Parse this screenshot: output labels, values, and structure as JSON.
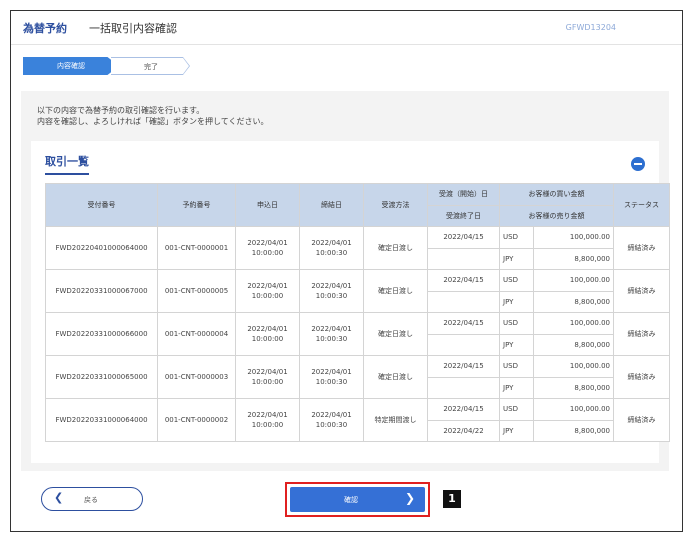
{
  "header": {
    "category": "為替予約",
    "title": "一括取引内容確認",
    "screen_code": "GFWD13204"
  },
  "steps": [
    {
      "label": "内容確認"
    },
    {
      "label": "完了"
    }
  ],
  "description": [
    "以下の内容で為替予約の取引確認を行います。",
    "内容を確認し、よろしければ「確認」ボタンを押してください。"
  ],
  "panel": {
    "title": "取引一覧"
  },
  "table": {
    "headers": {
      "receipt_no": "受付番号",
      "reservation_no": "予約番号",
      "applied_date": "申込日",
      "contract_date": "締結日",
      "delivery_method": "受渡方法",
      "delivery_start": "受渡（開始）日",
      "delivery_end": "受渡終了日",
      "buy_amount": "お客様の買い金額",
      "sell_amount": "お客様の売り金額",
      "status": "ステータス"
    },
    "rows": [
      {
        "receipt": "FWD20220401000064000",
        "reservation": "001-CNT-0000001",
        "applied_date": "2022/04/01",
        "applied_time": "10:00:00",
        "contract_date": "2022/04/01",
        "contract_time": "10:00:30",
        "method": "確定日渡し",
        "start": "2022/04/15",
        "end": "",
        "buy_ccy": "USD",
        "buy_amt": "100,000.00",
        "sell_ccy": "JPY",
        "sell_amt": "8,800,000",
        "status": "締結済み"
      },
      {
        "receipt": "FWD20220331000067000",
        "reservation": "001-CNT-0000005",
        "applied_date": "2022/04/01",
        "applied_time": "10:00:00",
        "contract_date": "2022/04/01",
        "contract_time": "10:00:30",
        "method": "確定日渡し",
        "start": "2022/04/15",
        "end": "",
        "buy_ccy": "USD",
        "buy_amt": "100,000.00",
        "sell_ccy": "JPY",
        "sell_amt": "8,800,000",
        "status": "締結済み"
      },
      {
        "receipt": "FWD20220331000066000",
        "reservation": "001-CNT-0000004",
        "applied_date": "2022/04/01",
        "applied_time": "10:00:00",
        "contract_date": "2022/04/01",
        "contract_time": "10:00:30",
        "method": "確定日渡し",
        "start": "2022/04/15",
        "end": "",
        "buy_ccy": "USD",
        "buy_amt": "100,000.00",
        "sell_ccy": "JPY",
        "sell_amt": "8,800,000",
        "status": "締結済み"
      },
      {
        "receipt": "FWD20220331000065000",
        "reservation": "001-CNT-0000003",
        "applied_date": "2022/04/01",
        "applied_time": "10:00:00",
        "contract_date": "2022/04/01",
        "contract_time": "10:00:30",
        "method": "確定日渡し",
        "start": "2022/04/15",
        "end": "",
        "buy_ccy": "USD",
        "buy_amt": "100,000.00",
        "sell_ccy": "JPY",
        "sell_amt": "8,800,000",
        "status": "締結済み"
      },
      {
        "receipt": "FWD20220331000064000",
        "reservation": "001-CNT-0000002",
        "applied_date": "2022/04/01",
        "applied_time": "10:00:00",
        "contract_date": "2022/04/01",
        "contract_time": "10:00:30",
        "method": "特定期間渡し",
        "start": "2022/04/15",
        "end": "2022/04/22",
        "buy_ccy": "USD",
        "buy_amt": "100,000.00",
        "sell_ccy": "JPY",
        "sell_amt": "8,800,000",
        "status": "締結済み"
      }
    ]
  },
  "footer": {
    "back_label": "戻る",
    "confirm_label": "確認",
    "marker": "1"
  },
  "colors": {
    "accent": "#2d4f9f",
    "button": "#3570d6",
    "header_cell": "#c7d6ea",
    "highlight": "#e02020"
  }
}
